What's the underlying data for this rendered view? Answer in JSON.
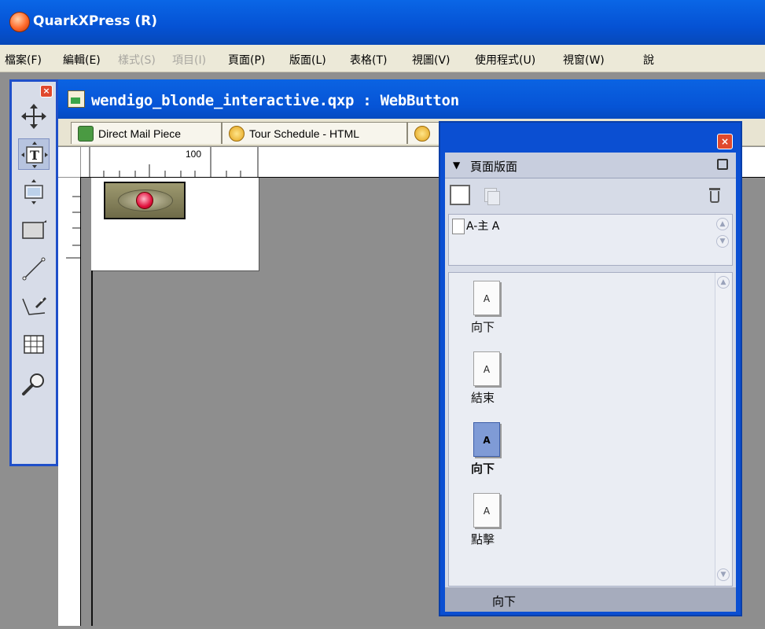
{
  "app": {
    "title": "QuarkXPress (R)"
  },
  "menu": [
    {
      "label": "檔案(F)",
      "enabled": true
    },
    {
      "label": "編輯(E)",
      "enabled": true
    },
    {
      "label": "樣式(S)",
      "enabled": false
    },
    {
      "label": "項目(I)",
      "enabled": false
    },
    {
      "label": "頁面(P)",
      "enabled": true
    },
    {
      "label": "版面(L)",
      "enabled": true
    },
    {
      "label": "表格(T)",
      "enabled": true
    },
    {
      "label": "視圖(V)",
      "enabled": true
    },
    {
      "label": "使用程式(U)",
      "enabled": true
    },
    {
      "label": "視窗(W)",
      "enabled": true
    },
    {
      "label": "說",
      "enabled": true
    }
  ],
  "tools": [
    "move-tool",
    "content-tool",
    "picture-content-tool",
    "box-tool",
    "line-tool",
    "bezier-pen-tool",
    "table-tool",
    "zoom-tool"
  ],
  "document": {
    "title": "wendigo_blonde_interactive.qxp : WebButton",
    "tabs": [
      {
        "label": "Direct Mail Piece"
      },
      {
        "label": "Tour Schedule - HTML"
      },
      {
        "label": ""
      }
    ],
    "ruler_label": "100"
  },
  "palette": {
    "title": "頁面版面",
    "masters": [
      {
        "label": "A-主 A"
      }
    ],
    "pages": [
      {
        "letter": "A",
        "label": "向下",
        "current": false
      },
      {
        "letter": "A",
        "label": "結束",
        "current": false
      },
      {
        "letter": "A",
        "label": "向下",
        "current": true
      },
      {
        "letter": "A",
        "label": "點擊",
        "current": false
      }
    ],
    "footer": "向下"
  },
  "icons": {
    "app": "quarkxpress-icon",
    "close": "close-icon",
    "palette_menu": "palette-menu-icon",
    "new_page": "blank-page-icon",
    "duplicate": "duplicate-page-icon",
    "delete": "trash-icon"
  }
}
